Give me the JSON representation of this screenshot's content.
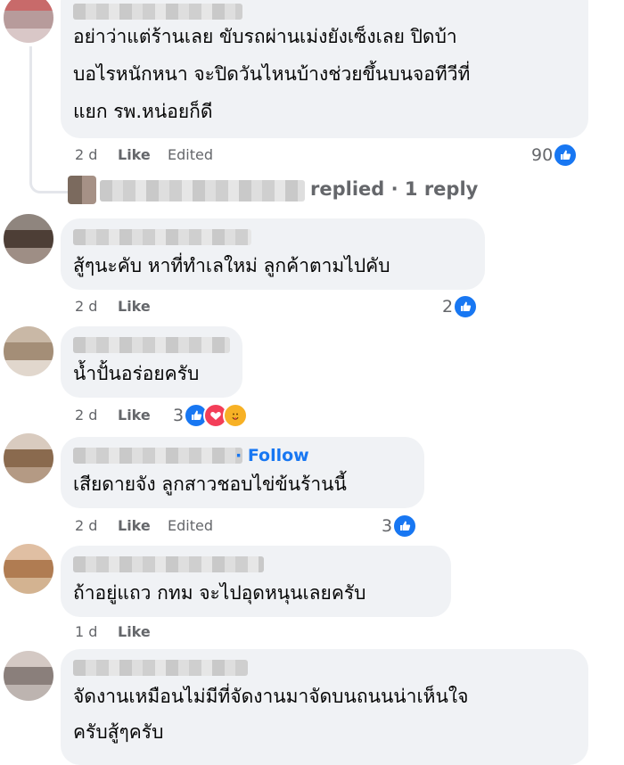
{
  "comments": [
    {
      "text_lines": [
        "อย่าว่าแต่ร้านเลย ขับรถผ่านเม่งยังเซ็งเลย ปิดบ้า",
        "บอไรหนักหนา จะปิดวันไหนบ้างช่วยขึ้นบนจอทีวีที่",
        "แยก รพ.หน่อยก็ดี"
      ],
      "time": "2 d",
      "like": "Like",
      "edited": "Edited",
      "reaction_count": "90",
      "reaction_types": [
        "like"
      ]
    },
    {
      "text_lines": [
        "สู้ๆนะคับ หาที่ทำเลใหม่ ลูกค้าตามไปคับ"
      ],
      "time": "2 d",
      "like": "Like",
      "edited": "",
      "reaction_count": "2",
      "reaction_types": [
        "like"
      ]
    },
    {
      "text_lines": [
        "น้ำปั้นอร่อยครับ"
      ],
      "time": "2 d",
      "like": "Like",
      "edited": "",
      "reaction_count": "3",
      "reaction_types": [
        "like",
        "love",
        "care"
      ]
    },
    {
      "text_lines": [
        "เสียดายจัง ลูกสาวชอบไข่ข้นร้านนี้"
      ],
      "time": "2 d",
      "like": "Like",
      "edited": "Edited",
      "reaction_count": "3",
      "reaction_types": [
        "like"
      ],
      "follow": "· Follow"
    },
    {
      "text_lines": [
        "ถ้าอยู่แถว กทม จะไปอุดหนุนเลยครับ"
      ],
      "time": "1 d",
      "like": "Like",
      "edited": "",
      "reaction_count": "",
      "reaction_types": []
    },
    {
      "text_lines": [
        "จัดงานเหมือนไม่มีที่จัดงานมาจัดบนถนนน่าเห็นใจ",
        "ครับสู้ๆครับ"
      ],
      "time": "",
      "like": "",
      "edited": "",
      "reaction_count": "",
      "reaction_types": []
    }
  ],
  "reply_link": {
    "text": "replied · 1 reply"
  },
  "colors": {
    "bubble": "#f0f2f5",
    "meta": "#65676b",
    "accent": "#1877f2",
    "love": "#f33e58",
    "care": "#f7b125"
  },
  "icons": {
    "like": "like-reaction-icon",
    "love": "love-reaction-icon",
    "care": "care-reaction-icon"
  }
}
